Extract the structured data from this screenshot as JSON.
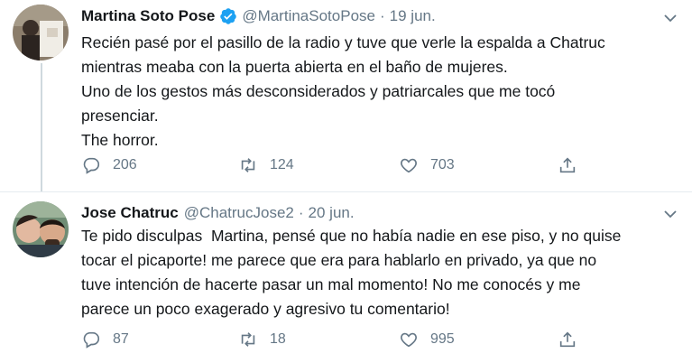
{
  "tweets": [
    {
      "author_name": "Martina Soto Pose",
      "handle": "@MartinaSotoPose",
      "separator": "·",
      "date": "19 jun.",
      "verified": true,
      "text": "Recién pasé por el pasillo de la radio y tuve que verle la espalda a Chatruc\nmientras meaba con la puerta abierta en el baño de mujeres.\nUno de los gestos más desconsiderados y patriarcales que me tocó\npresenciar.\nThe horror.",
      "replies": "206",
      "retweets": "124",
      "likes": "703"
    },
    {
      "author_name": "Jose Chatruc",
      "handle": "@ChatrucJose2",
      "separator": "·",
      "date": "20 jun.",
      "verified": false,
      "text": "Te pido disculpas  Martina, pensé que no había nadie en ese piso, y no quise\ntocar el picaporte! me parece que era para hablarlo en privado, ya que no\ntuve intención de hacerte pasar un mal momento! No me conocés y me\nparece un poco exagerado y agresivo tu comentario!",
      "replies": "87",
      "retweets": "18",
      "likes": "995"
    }
  ],
  "icons": {
    "verified": "verified-badge-icon",
    "caret": "chevron-down-icon",
    "reply": "reply-icon",
    "retweet": "retweet-icon",
    "like": "heart-icon",
    "share": "share-icon"
  },
  "colors": {
    "verified_blue": "#1da1f2",
    "muted_text": "#657786",
    "divider": "#e6ecf0"
  }
}
